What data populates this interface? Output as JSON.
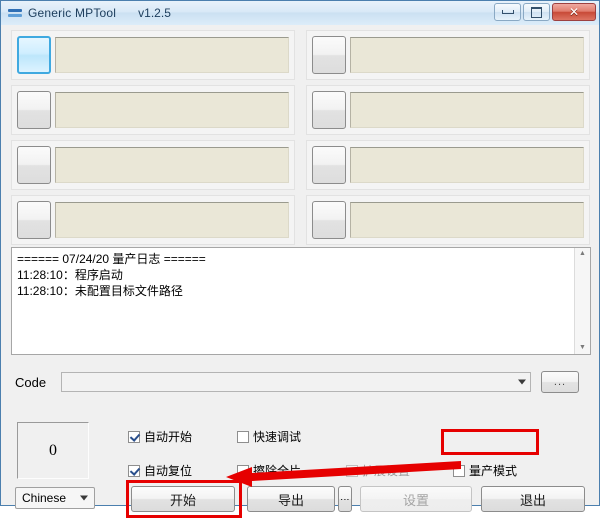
{
  "window": {
    "title": "Generic MPTool",
    "version": "v1.2.5",
    "app_icon": "app-bars-icon",
    "buttons": {
      "minimize": "minimize-icon",
      "maximize": "maximize-icon",
      "close": "✕"
    }
  },
  "slots": [
    {
      "id": 1,
      "active": true,
      "value": ""
    },
    {
      "id": 2,
      "active": false,
      "value": ""
    },
    {
      "id": 3,
      "active": false,
      "value": ""
    },
    {
      "id": 4,
      "active": false,
      "value": ""
    },
    {
      "id": 5,
      "active": false,
      "value": ""
    },
    {
      "id": 6,
      "active": false,
      "value": ""
    },
    {
      "id": 7,
      "active": false,
      "value": ""
    },
    {
      "id": 8,
      "active": false,
      "value": ""
    }
  ],
  "log": {
    "lines": [
      "====== 07/24/20 量产日志 ======",
      "11:28:10：程序启动",
      "11:28:10：未配置目标文件路径"
    ],
    "text": "====== 07/24/20 量产日志 ======\n11:28:10：程序启动\n11:28:10：未配置目标文件路径",
    "scroll_up_icon": "▲",
    "scroll_down_icon": "▼"
  },
  "code_row": {
    "label": "Code",
    "value": "",
    "placeholder": "",
    "dropdown_icon": "chevron-down-icon",
    "browse_label": "..."
  },
  "counter": {
    "value": "0"
  },
  "checkboxes": [
    {
      "label": "自动开始",
      "checked": true,
      "disabled": false
    },
    {
      "label": "快速调试",
      "checked": false,
      "disabled": false
    },
    {
      "label": "自动复位",
      "checked": true,
      "disabled": false
    },
    {
      "label": "擦除全片",
      "checked": false,
      "disabled": false
    },
    {
      "label": "扩展设置",
      "checked": false,
      "disabled": true
    },
    {
      "label": "量产模式",
      "checked": false,
      "disabled": false
    }
  ],
  "language": {
    "selected": "Chinese",
    "dropdown_icon": "chevron-down-icon"
  },
  "buttons": {
    "start": "开始",
    "export": "导出",
    "more": "⋮",
    "settings": "设置",
    "exit": "退出"
  },
  "annotations": {
    "highlight_color": "#e60000",
    "boxes": [
      "量产模式",
      "开始"
    ],
    "arrow_points_to": "开始"
  }
}
